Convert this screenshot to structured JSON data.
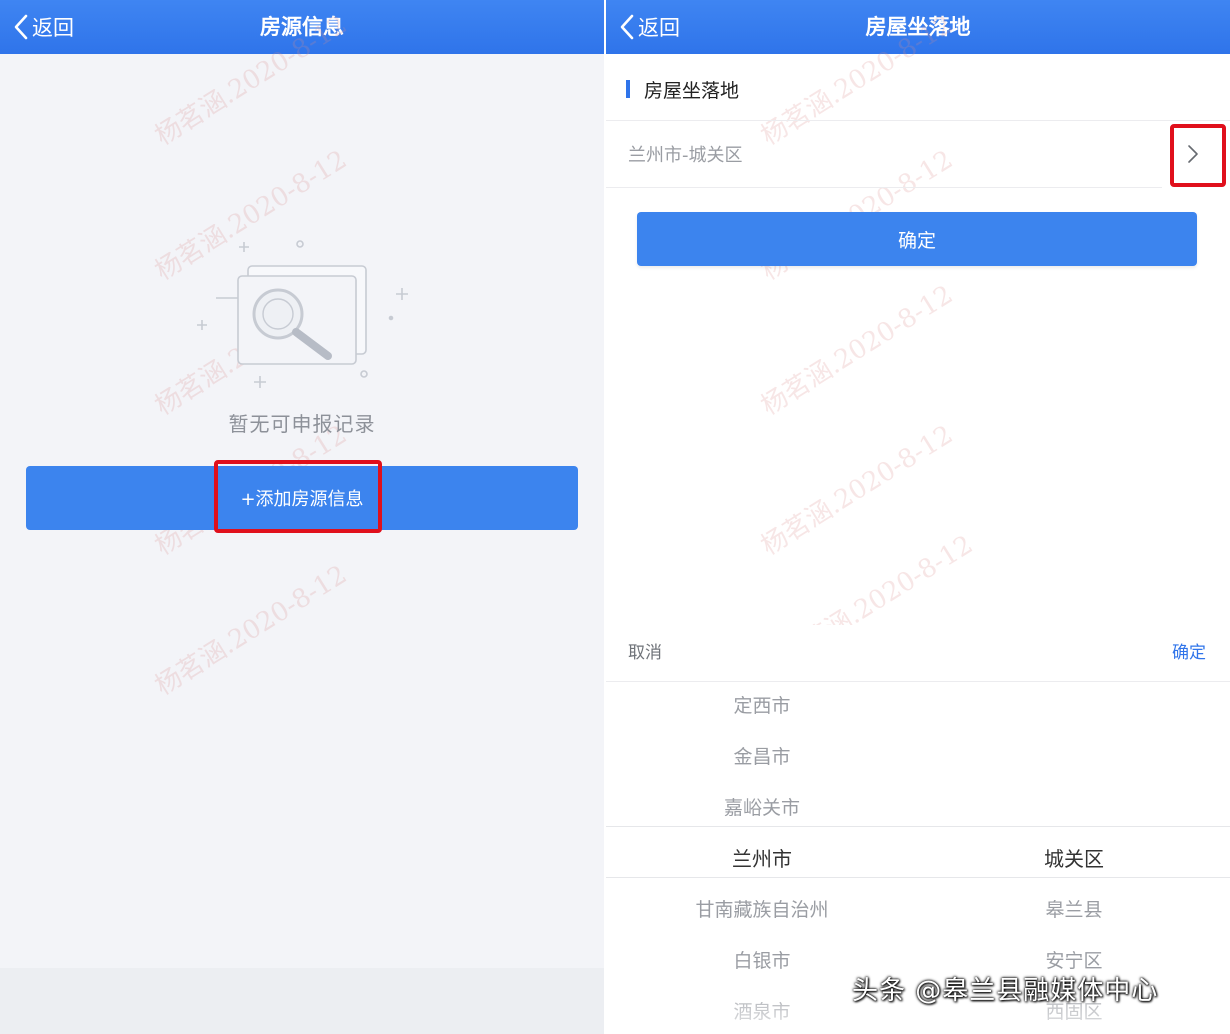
{
  "left": {
    "nav": {
      "back_label": "返回",
      "title": "房源信息"
    },
    "empty_text": "暂无可申报记录",
    "add_button_label": "+添加房源信息"
  },
  "right": {
    "nav": {
      "back_label": "返回",
      "title": "房屋坐落地"
    },
    "section_title": "房屋坐落地",
    "location_value": "兰州市-城关区",
    "confirm_button_label": "确定",
    "picker": {
      "cancel_label": "取消",
      "ok_label": "确定",
      "city_options": [
        "定西市",
        "金昌市",
        "嘉峪关市",
        "兰州市",
        "甘南藏族自治州",
        "白银市",
        "酒泉市"
      ],
      "district_options": [
        "城关区",
        "皋兰县",
        "安宁区",
        "西固区"
      ],
      "selected_city": "兰州市",
      "selected_district": "城关区"
    }
  },
  "watermark_text": "杨茗涵.2020-8-12",
  "credit_text": "头条 @皋兰县融媒体中心",
  "colors": {
    "nav_blue": "#2f74ea",
    "button_blue": "#3c84ee",
    "highlight_red": "#e0101c"
  }
}
